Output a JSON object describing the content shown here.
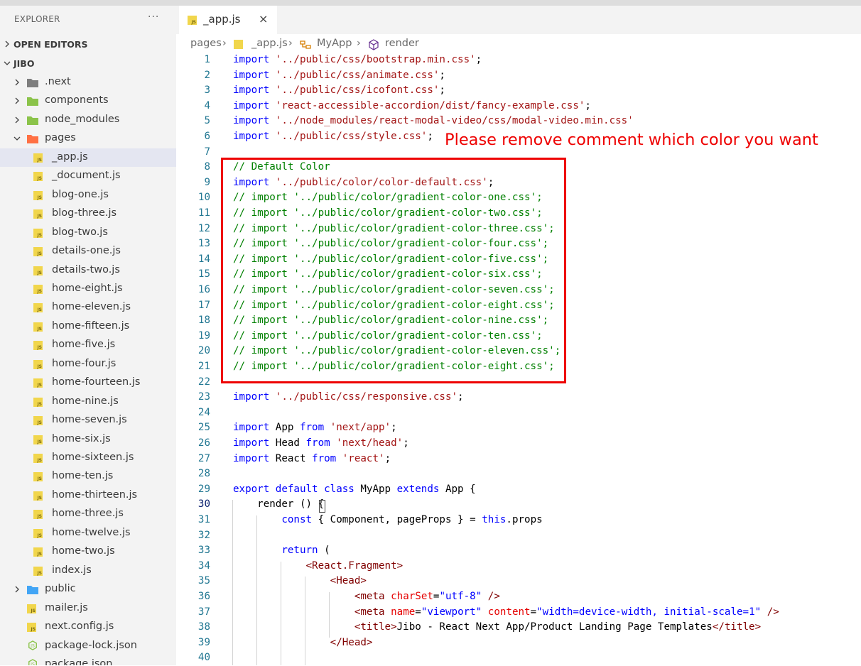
{
  "explorer": {
    "title": "EXPLORER",
    "more": "···",
    "open_editors": "OPEN EDITORS",
    "project": "JIBO",
    "tree": [
      {
        "label": ".next",
        "type": "folder",
        "depth": 1,
        "expanded": false,
        "icon": "folder-icon",
        "color": "#7d7d7d"
      },
      {
        "label": "components",
        "type": "folder",
        "depth": 1,
        "expanded": false,
        "icon": "components-folder-icon",
        "color": "#8bc34a"
      },
      {
        "label": "node_modules",
        "type": "folder",
        "depth": 1,
        "expanded": false,
        "icon": "node-folder-icon",
        "color": "#8bc34a"
      },
      {
        "label": "pages",
        "type": "folder",
        "depth": 1,
        "expanded": true,
        "icon": "pages-folder-icon",
        "color": "#ff7043"
      },
      {
        "label": "_app.js",
        "type": "js",
        "depth": 2,
        "selected": true
      },
      {
        "label": "_document.js",
        "type": "js",
        "depth": 2
      },
      {
        "label": "blog-one.js",
        "type": "js",
        "depth": 2
      },
      {
        "label": "blog-three.js",
        "type": "js",
        "depth": 2
      },
      {
        "label": "blog-two.js",
        "type": "js",
        "depth": 2
      },
      {
        "label": "details-one.js",
        "type": "js",
        "depth": 2
      },
      {
        "label": "details-two.js",
        "type": "js",
        "depth": 2
      },
      {
        "label": "home-eight.js",
        "type": "js",
        "depth": 2
      },
      {
        "label": "home-eleven.js",
        "type": "js",
        "depth": 2
      },
      {
        "label": "home-fifteen.js",
        "type": "js",
        "depth": 2
      },
      {
        "label": "home-five.js",
        "type": "js",
        "depth": 2
      },
      {
        "label": "home-four.js",
        "type": "js",
        "depth": 2
      },
      {
        "label": "home-fourteen.js",
        "type": "js",
        "depth": 2
      },
      {
        "label": "home-nine.js",
        "type": "js",
        "depth": 2
      },
      {
        "label": "home-seven.js",
        "type": "js",
        "depth": 2
      },
      {
        "label": "home-six.js",
        "type": "js",
        "depth": 2
      },
      {
        "label": "home-sixteen.js",
        "type": "js",
        "depth": 2
      },
      {
        "label": "home-ten.js",
        "type": "js",
        "depth": 2
      },
      {
        "label": "home-thirteen.js",
        "type": "js",
        "depth": 2
      },
      {
        "label": "home-three.js",
        "type": "js",
        "depth": 2
      },
      {
        "label": "home-twelve.js",
        "type": "js",
        "depth": 2
      },
      {
        "label": "home-two.js",
        "type": "js",
        "depth": 2
      },
      {
        "label": "index.js",
        "type": "js",
        "depth": 2
      },
      {
        "label": "public",
        "type": "folder",
        "depth": 1,
        "expanded": false,
        "icon": "public-folder-icon",
        "color": "#42a5f5"
      },
      {
        "label": "mailer.js",
        "type": "js",
        "depth": 1
      },
      {
        "label": "next.config.js",
        "type": "js",
        "depth": 1
      },
      {
        "label": "package-lock.json",
        "type": "node",
        "depth": 1
      },
      {
        "label": "package.json",
        "type": "node",
        "depth": 1
      }
    ]
  },
  "tab": {
    "name": "_app.js",
    "close": "×",
    "icon": "js-file-icon"
  },
  "breadcrumb": {
    "items": [
      "pages",
      "_app.js",
      "MyApp",
      "render"
    ],
    "separator": "›"
  },
  "annotation": {
    "text": "Please remove comment which color you want",
    "color": "#ee0000"
  },
  "editor": {
    "current_line": 30,
    "lines": [
      {
        "n": 1,
        "t": [
          [
            "kw",
            "import"
          ],
          [
            "p",
            " "
          ],
          [
            "str",
            "'../public/css/bootstrap.min.css'"
          ],
          [
            "p",
            ";"
          ]
        ]
      },
      {
        "n": 2,
        "t": [
          [
            "kw",
            "import"
          ],
          [
            "p",
            " "
          ],
          [
            "str",
            "'../public/css/animate.css'"
          ],
          [
            "p",
            ";"
          ]
        ]
      },
      {
        "n": 3,
        "t": [
          [
            "kw",
            "import"
          ],
          [
            "p",
            " "
          ],
          [
            "str",
            "'../public/css/icofont.css'"
          ],
          [
            "p",
            ";"
          ]
        ]
      },
      {
        "n": 4,
        "t": [
          [
            "kw",
            "import"
          ],
          [
            "p",
            " "
          ],
          [
            "str",
            "'react-accessible-accordion/dist/fancy-example.css'"
          ],
          [
            "p",
            ";"
          ]
        ]
      },
      {
        "n": 5,
        "t": [
          [
            "kw",
            "import"
          ],
          [
            "p",
            " "
          ],
          [
            "str",
            "'../node_modules/react-modal-video/css/modal-video.min.css'"
          ]
        ]
      },
      {
        "n": 6,
        "t": [
          [
            "kw",
            "import"
          ],
          [
            "p",
            " "
          ],
          [
            "str",
            "'../public/css/style.css'"
          ],
          [
            "p",
            ";"
          ]
        ]
      },
      {
        "n": 7,
        "t": []
      },
      {
        "n": 8,
        "t": [
          [
            "cm",
            "// Default Color"
          ]
        ]
      },
      {
        "n": 9,
        "t": [
          [
            "kw",
            "import"
          ],
          [
            "p",
            " "
          ],
          [
            "str",
            "'../public/color/color-default.css'"
          ],
          [
            "p",
            ";"
          ]
        ]
      },
      {
        "n": 10,
        "t": [
          [
            "cm",
            "// import '../public/color/gradient-color-one.css';"
          ]
        ]
      },
      {
        "n": 11,
        "t": [
          [
            "cm",
            "// import '../public/color/gradient-color-two.css';"
          ]
        ]
      },
      {
        "n": 12,
        "t": [
          [
            "cm",
            "// import '../public/color/gradient-color-three.css';"
          ]
        ]
      },
      {
        "n": 13,
        "t": [
          [
            "cm",
            "// import '../public/color/gradient-color-four.css';"
          ]
        ]
      },
      {
        "n": 14,
        "t": [
          [
            "cm",
            "// import '../public/color/gradient-color-five.css';"
          ]
        ]
      },
      {
        "n": 15,
        "t": [
          [
            "cm",
            "// import '../public/color/gradient-color-six.css';"
          ]
        ]
      },
      {
        "n": 16,
        "t": [
          [
            "cm",
            "// import '../public/color/gradient-color-seven.css';"
          ]
        ]
      },
      {
        "n": 17,
        "t": [
          [
            "cm",
            "// import '../public/color/gradient-color-eight.css';"
          ]
        ]
      },
      {
        "n": 18,
        "t": [
          [
            "cm",
            "// import '../public/color/gradient-color-nine.css';"
          ]
        ]
      },
      {
        "n": 19,
        "t": [
          [
            "cm",
            "// import '../public/color/gradient-color-ten.css';"
          ]
        ]
      },
      {
        "n": 20,
        "t": [
          [
            "cm",
            "// import '../public/color/gradient-color-eleven.css';"
          ]
        ]
      },
      {
        "n": 21,
        "t": [
          [
            "cm",
            "// import '../public/color/gradient-color-eight.css';"
          ]
        ]
      },
      {
        "n": 22,
        "t": []
      },
      {
        "n": 23,
        "t": [
          [
            "kw",
            "import"
          ],
          [
            "p",
            " "
          ],
          [
            "str",
            "'../public/css/responsive.css'"
          ],
          [
            "p",
            ";"
          ]
        ]
      },
      {
        "n": 24,
        "t": []
      },
      {
        "n": 25,
        "t": [
          [
            "kw",
            "import"
          ],
          [
            "p",
            " App "
          ],
          [
            "kw",
            "from"
          ],
          [
            "p",
            " "
          ],
          [
            "str",
            "'next/app'"
          ],
          [
            "p",
            ";"
          ]
        ]
      },
      {
        "n": 26,
        "t": [
          [
            "kw",
            "import"
          ],
          [
            "p",
            " Head "
          ],
          [
            "kw",
            "from"
          ],
          [
            "p",
            " "
          ],
          [
            "str",
            "'next/head'"
          ],
          [
            "p",
            ";"
          ]
        ]
      },
      {
        "n": 27,
        "t": [
          [
            "kw",
            "import"
          ],
          [
            "p",
            " React "
          ],
          [
            "kw",
            "from"
          ],
          [
            "p",
            " "
          ],
          [
            "str",
            "'react'"
          ],
          [
            "p",
            ";"
          ]
        ]
      },
      {
        "n": 28,
        "t": []
      },
      {
        "n": 29,
        "t": [
          [
            "kw",
            "export default class"
          ],
          [
            "p",
            " MyApp "
          ],
          [
            "kw",
            "extends"
          ],
          [
            "p",
            " App {"
          ]
        ]
      },
      {
        "n": 30,
        "t": [
          [
            "p",
            "    render () {"
          ]
        ]
      },
      {
        "n": 31,
        "t": [
          [
            "p",
            "        "
          ],
          [
            "kw",
            "const"
          ],
          [
            "p",
            " { Component, pageProps } = "
          ],
          [
            "kw",
            "this"
          ],
          [
            "p",
            ".props"
          ]
        ]
      },
      {
        "n": 32,
        "t": []
      },
      {
        "n": 33,
        "t": [
          [
            "p",
            "        "
          ],
          [
            "kw",
            "return"
          ],
          [
            "p",
            " ("
          ]
        ]
      },
      {
        "n": 34,
        "t": [
          [
            "p",
            "            "
          ],
          [
            "tag",
            "<React.Fragment>"
          ]
        ]
      },
      {
        "n": 35,
        "t": [
          [
            "p",
            "                "
          ],
          [
            "tag",
            "<Head>"
          ]
        ]
      },
      {
        "n": 36,
        "t": [
          [
            "p",
            "                    "
          ],
          [
            "tag",
            "<meta"
          ],
          [
            "p",
            " "
          ],
          [
            "attr",
            "charSet"
          ],
          [
            "p",
            "="
          ],
          [
            "kw",
            "\"utf-8\""
          ],
          [
            "p",
            " "
          ],
          [
            "tag",
            "/>"
          ]
        ]
      },
      {
        "n": 37,
        "t": [
          [
            "p",
            "                    "
          ],
          [
            "tag",
            "<meta"
          ],
          [
            "p",
            " "
          ],
          [
            "attr",
            "name"
          ],
          [
            "p",
            "="
          ],
          [
            "kw",
            "\"viewport\""
          ],
          [
            "p",
            " "
          ],
          [
            "attr",
            "content"
          ],
          [
            "p",
            "="
          ],
          [
            "kw",
            "\"width=device-width, initial-scale=1\""
          ],
          [
            "p",
            " "
          ],
          [
            "tag",
            "/>"
          ]
        ]
      },
      {
        "n": 38,
        "t": [
          [
            "p",
            "                    "
          ],
          [
            "tag",
            "<title>"
          ],
          [
            "p",
            "Jibo - React Next App/Product Landing Page Templates"
          ],
          [
            "tag",
            "</title>"
          ]
        ]
      },
      {
        "n": 39,
        "t": [
          [
            "p",
            "                "
          ],
          [
            "tag",
            "</Head>"
          ]
        ]
      },
      {
        "n": 40,
        "t": []
      }
    ]
  }
}
